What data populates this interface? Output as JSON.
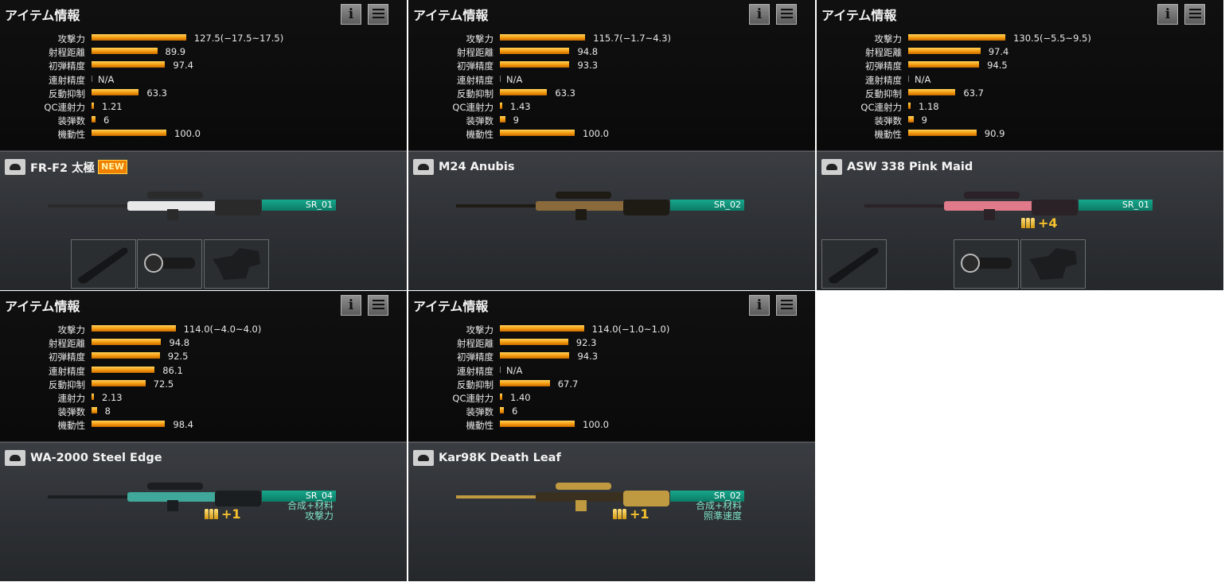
{
  "panel_title": "アイテム情報",
  "cards": [
    {
      "stats": [
        {
          "label": "攻撃力",
          "value": "127.5(−17.5~17.5)",
          "fill": 0.72
        },
        {
          "label": "射程距離",
          "value": "89.9",
          "fill": 0.5
        },
        {
          "label": "初弾精度",
          "value": "97.4",
          "fill": 0.56
        },
        {
          "label": "連射精度",
          "value": "N/A",
          "fill": 0.0
        },
        {
          "label": "反動抑制",
          "value": "63.3",
          "fill": 0.36
        },
        {
          "label": "QC連射力",
          "value": "1.21",
          "fill": 0.01
        },
        {
          "label": "装弾数",
          "value": "6",
          "fill": 0.03
        },
        {
          "label": "機動性",
          "value": "100.0",
          "fill": 0.57
        }
      ],
      "weapon_name": "FR-F2 太極",
      "badge": "NEW",
      "tag": "SR_01",
      "tag_lines": [],
      "ammo": "",
      "slots": [
        "grip",
        "scope",
        "stock"
      ]
    },
    {
      "stats": [
        {
          "label": "攻撃力",
          "value": "115.7(−1.7~4.3)",
          "fill": 0.65
        },
        {
          "label": "射程距離",
          "value": "94.8",
          "fill": 0.53
        },
        {
          "label": "初弾精度",
          "value": "93.3",
          "fill": 0.53
        },
        {
          "label": "連射精度",
          "value": "N/A",
          "fill": 0.0
        },
        {
          "label": "反動抑制",
          "value": "63.3",
          "fill": 0.36
        },
        {
          "label": "QC連射力",
          "value": "1.43",
          "fill": 0.01
        },
        {
          "label": "装弾数",
          "value": "9",
          "fill": 0.04
        },
        {
          "label": "機動性",
          "value": "100.0",
          "fill": 0.57
        }
      ],
      "weapon_name": "M24 Anubis",
      "badge": "",
      "tag": "SR_02",
      "tag_lines": [],
      "ammo": "",
      "slots": []
    },
    {
      "stats": [
        {
          "label": "攻撃力",
          "value": "130.5(−5.5~9.5)",
          "fill": 0.74
        },
        {
          "label": "射程距離",
          "value": "97.4",
          "fill": 0.55
        },
        {
          "label": "初弾精度",
          "value": "94.5",
          "fill": 0.54
        },
        {
          "label": "連射精度",
          "value": "N/A",
          "fill": 0.0
        },
        {
          "label": "反動抑制",
          "value": "63.7",
          "fill": 0.36
        },
        {
          "label": "QC連射力",
          "value": "1.18",
          "fill": 0.01
        },
        {
          "label": "装弾数",
          "value": "9",
          "fill": 0.04
        },
        {
          "label": "機動性",
          "value": "90.9",
          "fill": 0.52
        }
      ],
      "weapon_name": "ASW 338 Pink Maid",
      "badge": "",
      "tag": "SR_01",
      "tag_lines": [],
      "ammo": "+4",
      "slots": [
        "grip",
        "",
        "scope",
        "stock"
      ]
    },
    {
      "stats": [
        {
          "label": "攻撃力",
          "value": "114.0(−4.0~4.0)",
          "fill": 0.64
        },
        {
          "label": "射程距離",
          "value": "94.8",
          "fill": 0.53
        },
        {
          "label": "初弾精度",
          "value": "92.5",
          "fill": 0.52
        },
        {
          "label": "連射精度",
          "value": "86.1",
          "fill": 0.48
        },
        {
          "label": "反動抑制",
          "value": "72.5",
          "fill": 0.41
        },
        {
          "label": "連射力",
          "value": "2.13",
          "fill": 0.01
        },
        {
          "label": "装弾数",
          "value": "8",
          "fill": 0.04
        },
        {
          "label": "機動性",
          "value": "98.4",
          "fill": 0.56
        }
      ],
      "weapon_name": "WA-2000 Steel Edge",
      "badge": "",
      "tag": "SR_04",
      "tag_lines": [
        "合成+材料",
        "攻撃力"
      ],
      "ammo": "+1",
      "slots": []
    },
    {
      "stats": [
        {
          "label": "攻撃力",
          "value": "114.0(−1.0~1.0)",
          "fill": 0.64
        },
        {
          "label": "射程距離",
          "value": "92.3",
          "fill": 0.52
        },
        {
          "label": "初弾精度",
          "value": "94.3",
          "fill": 0.53
        },
        {
          "label": "連射精度",
          "value": "N/A",
          "fill": 0.0
        },
        {
          "label": "反動抑制",
          "value": "67.7",
          "fill": 0.38
        },
        {
          "label": "QC連射力",
          "value": "1.40",
          "fill": 0.01
        },
        {
          "label": "装弾数",
          "value": "6",
          "fill": 0.03
        },
        {
          "label": "機動性",
          "value": "100.0",
          "fill": 0.57
        }
      ],
      "weapon_name": "Kar98K Death Leaf",
      "badge": "",
      "tag": "SR_02",
      "tag_lines": [
        "合成+材料",
        "照準速度"
      ],
      "ammo": "+1",
      "slots": []
    }
  ],
  "icons": {
    "info": "info-icon",
    "detail": "detail-list-icon",
    "item_type": "duck-icon"
  },
  "colors": {
    "bar": "#f49b10",
    "tag": "#0c7b65",
    "tag_text": "#7fe3c8",
    "ammo": "#f5c12e",
    "badge": "#f08000"
  }
}
